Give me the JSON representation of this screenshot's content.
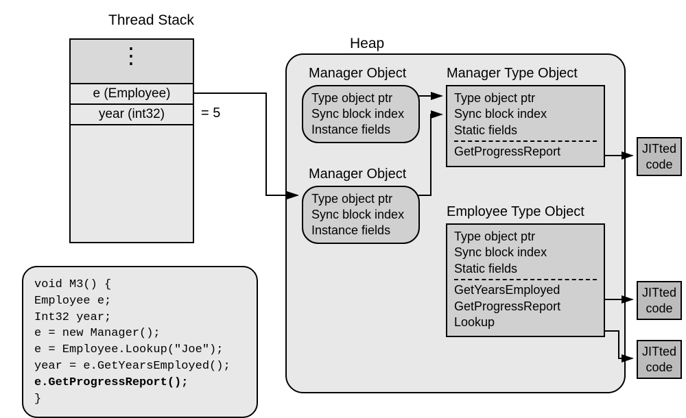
{
  "titles": {
    "stack": "Thread Stack",
    "heap": "Heap"
  },
  "stack": {
    "e": "e (Employee)",
    "year": "year (int32)",
    "eq": "=  5"
  },
  "heap_objects": {
    "mgr1": {
      "title": "Manager Object",
      "l1": "Type object ptr",
      "l2": "Sync block index",
      "l3": "Instance fields"
    },
    "mgr2": {
      "title": "Manager Object",
      "l1": "Type object ptr",
      "l2": "Sync block index",
      "l3": "Instance fields"
    }
  },
  "type_objects": {
    "mgr": {
      "title": "Manager Type Object",
      "l1": "Type object ptr",
      "l2": "Sync block index",
      "l3": "Static fields",
      "m1": "GetProgressReport"
    },
    "emp": {
      "title": "Employee Type Object",
      "l1": "Type object ptr",
      "l2": "Sync block index",
      "l3": "Static fields",
      "m1": "GetYearsEmployed",
      "m2": "GetProgressReport",
      "m3": "Lookup"
    }
  },
  "jit": {
    "j1": "JITted",
    "j2": "code"
  },
  "code": {
    "l0": "void M3()  {",
    "l1": "  Employee e;",
    "l2": "  Int32 year;",
    "l3": "  e = new Manager();",
    "l4": "  e = Employee.Lookup(\"Joe\");",
    "l5": "  year = e.GetYearsEmployed();",
    "l6": "  e.GetProgressReport();",
    "l7": "}"
  }
}
